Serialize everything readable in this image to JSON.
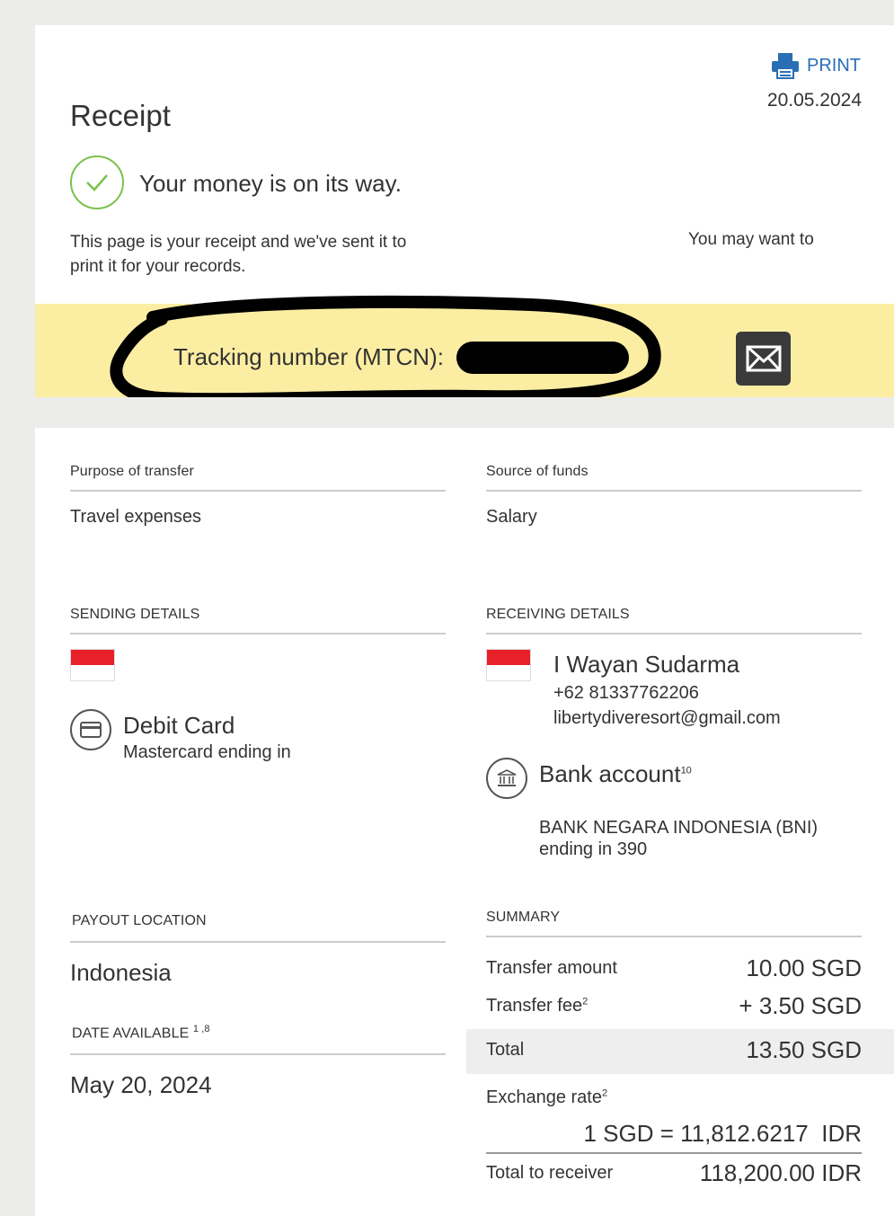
{
  "header": {
    "title": "Receipt",
    "print_label": "PRINT",
    "date": "20.05.2024"
  },
  "status": {
    "headline": "Your money is on its way.",
    "intro_left": "This page is your receipt and we've sent it to",
    "intro_right": "You may want to",
    "intro_line2": "print it for your records."
  },
  "tracking": {
    "label": "Tracking number (MTCN):"
  },
  "purpose": {
    "label": "Purpose of transfer",
    "value": "Travel expenses"
  },
  "source": {
    "label": "Source of funds",
    "value": "Salary"
  },
  "sending": {
    "label": "SENDING DETAILS",
    "method_title": "Debit Card",
    "method_sub": "Mastercard ending in"
  },
  "receiving": {
    "label": "RECEIVING DETAILS",
    "name": "I Wayan Sudarma",
    "phone": "+62 81337762206",
    "email": "libertydiveresort@gmail.com",
    "method_title": "Bank account",
    "method_sup": "10",
    "bank_name": "BANK NEGARA INDONESIA (BNI)",
    "bank_ending": "ending in 390"
  },
  "payout": {
    "label": "PAYOUT LOCATION",
    "value": "Indonesia",
    "date_label": "DATE AVAILABLE",
    "date_sup": "1 ,8",
    "date_value": "May 20, 2024"
  },
  "summary": {
    "label": "SUMMARY",
    "transfer_amount_label": "Transfer amount",
    "transfer_amount": "10.00 SGD",
    "fee_label": "Transfer fee",
    "fee_sup": "2",
    "fee": "+ 3.50 SGD",
    "total_label": "Total",
    "total": "13.50 SGD",
    "rate_label": "Exchange rate",
    "rate_sup": "2",
    "rate": "1 SGD = 11,812.6217  IDR",
    "receiver_label": "Total to receiver",
    "receiver_total": "118,200.00 IDR"
  },
  "colors": {
    "band": "#fbeea3",
    "accent_link": "#2a6fb5",
    "check_green": "#7cc14a",
    "sg_red": "#e8202a",
    "id_red": "#e8202a"
  }
}
